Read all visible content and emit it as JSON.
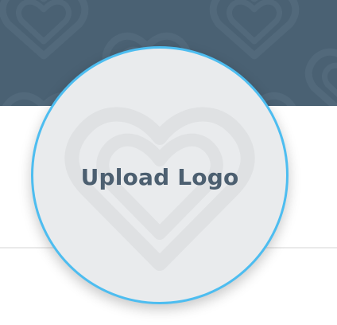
{
  "colors": {
    "banner_background": "#4a6173",
    "upload_circle_border": "#4dbdf0",
    "upload_circle_fill": "#e9ebed",
    "label_text": "#4c5f70"
  },
  "icons": {
    "banner_pattern": "heart-outline-pattern-icon",
    "watermark": "heart-outline-icon"
  },
  "logo_upload": {
    "label": "Upload Logo"
  }
}
